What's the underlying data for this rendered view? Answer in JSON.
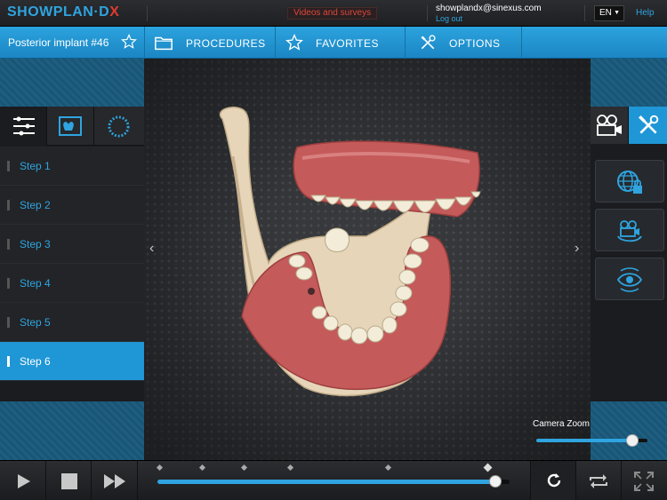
{
  "app": {
    "brand_main": "SHOWPLAN·D",
    "brand_accent": "X",
    "brand_color": "#2fa4e0",
    "brand_accent_color": "#e03a2e"
  },
  "topbar": {
    "videos_label": "Videos and surveys",
    "user_email": "showplandx@sinexus.com",
    "logout_label": "Log out",
    "language": "EN",
    "help_label": "Help"
  },
  "navbar": {
    "case_title": "Posterior implant #46",
    "favorite_icon": "star-outline-icon",
    "items": [
      {
        "label": "PROCEDURES",
        "icon": "folder-icon"
      },
      {
        "label": "FAVORITES",
        "icon": "star-icon"
      },
      {
        "label": "OPTIONS",
        "icon": "tools-icon"
      }
    ]
  },
  "left_panel": {
    "tabs": [
      {
        "icon": "steps-list-icon",
        "active": true
      },
      {
        "icon": "xray-icon",
        "active": false
      },
      {
        "icon": "circle-dial-icon",
        "active": false
      }
    ],
    "steps": [
      {
        "label": "Step 1",
        "active": false
      },
      {
        "label": "Step 2",
        "active": false
      },
      {
        "label": "Step 3",
        "active": false
      },
      {
        "label": "Step 4",
        "active": false
      },
      {
        "label": "Step 5",
        "active": false
      },
      {
        "label": "Step 6",
        "active": true
      }
    ]
  },
  "right_panel": {
    "tabs": [
      {
        "icon": "camera-icon",
        "active": false
      },
      {
        "icon": "tools-icon",
        "active": true
      }
    ],
    "buttons": [
      {
        "icon": "globe-lock-icon"
      },
      {
        "icon": "camera-rotate-icon"
      },
      {
        "icon": "eye-rotate-icon"
      }
    ]
  },
  "viewport": {
    "model": "3D jaw model with teeth and gums",
    "prev_arrow": "‹",
    "next_arrow": "›"
  },
  "camera_zoom": {
    "label": "Camera Zoom",
    "level": 0.86
  },
  "playback": {
    "controls": [
      "play-icon",
      "stop-icon",
      "fast-forward-icon"
    ],
    "progress": 0.96,
    "step_markers": [
      0.0,
      0.12,
      0.24,
      0.37,
      0.65,
      0.93
    ],
    "right_controls": [
      "refresh-icon",
      "repeat-icon",
      "fullscreen-icon"
    ]
  }
}
